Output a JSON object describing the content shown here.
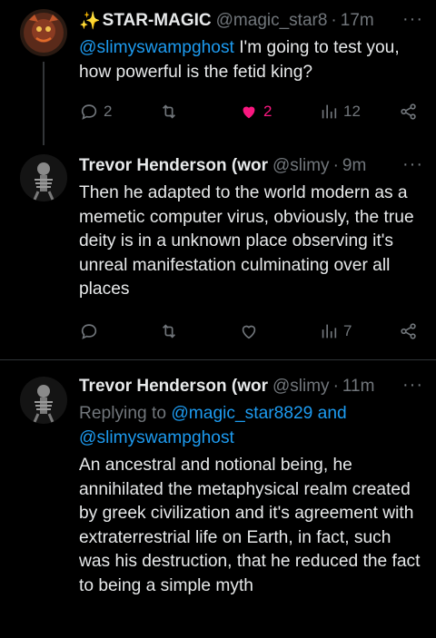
{
  "tweets": [
    {
      "name": "STAR-MAGIC",
      "name_prefix": "✨",
      "handle": "@magic_star8",
      "dot": "·",
      "time": "17m",
      "more": "···",
      "mention": "@slimyswampghost",
      "text": " I'm going to test you, how powerful is the fetid king?",
      "replies": "2",
      "retweets": "",
      "likes": "2",
      "views": "12",
      "liked": true
    },
    {
      "name": "Trevor Henderson (wor",
      "handle": "@slimy",
      "dot": "·",
      "time": "9m",
      "more": "···",
      "text": "Then he adapted to the world modern as a memetic computer virus, obviously, the true deity is in a unknown place observing it's unreal manifestation culminating over all places",
      "replies": "",
      "retweets": "",
      "likes": "",
      "views": "7"
    },
    {
      "name": "Trevor Henderson (wor",
      "handle": "@slimy",
      "dot": "·",
      "time": "11m",
      "more": "···",
      "replying_to_label": "Replying to ",
      "replying_to_user1": "@magic_star8829",
      "replying_and": " and",
      "replying_to_user2": "@slimyswampghost",
      "text": "An ancestral and notional being, he annihilated the metaphysical realm created by greek civilization and it's agreement with extraterrestrial life on Earth, in fact, such was his destruction, that he reduced the fact to being a simple myth"
    }
  ],
  "colors": {
    "background": "#000000",
    "text": "#e7e9ea",
    "muted": "#71767b",
    "accent": "#1d9bf0",
    "like": "#f91880"
  },
  "icons": [
    "reply-icon",
    "retweet-icon",
    "like-icon",
    "views-icon",
    "share-icon",
    "more-icon"
  ]
}
